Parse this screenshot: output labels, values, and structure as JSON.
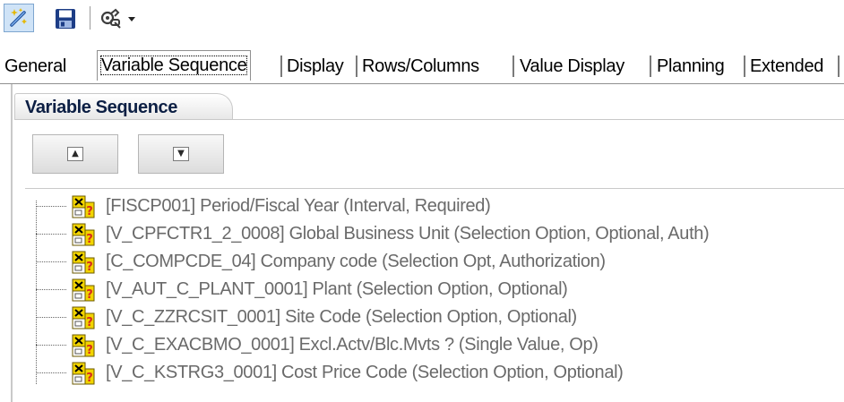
{
  "toolbar": {
    "buttons": [
      {
        "icon": "magic-wand-icon",
        "pressed": true
      },
      {
        "icon": "floppy-disk-icon"
      },
      {
        "icon": "tools-icon",
        "dropdown": true
      }
    ]
  },
  "tabs": [
    {
      "label": "General"
    },
    {
      "label": "Variable Sequence",
      "active": true
    },
    {
      "label": "Display"
    },
    {
      "label": "Rows/Columns"
    },
    {
      "label": "Value Display"
    },
    {
      "label": "Planning"
    },
    {
      "label": "Extended"
    }
  ],
  "group": {
    "title": "Variable Sequence",
    "move_up_icon": "triangle-up-icon",
    "move_down_icon": "triangle-down-icon"
  },
  "variables": [
    {
      "label": "[FISCP001] Period/Fiscal Year (Interval, Required)"
    },
    {
      "label": "[V_CPFCTR1_2_0008] Global Business Unit (Selection Option, Optional, Auth)"
    },
    {
      "label": "[C_COMPCDE_04] Company code (Selection Opt, Authorization)"
    },
    {
      "label": "[V_AUT_C_PLANT_0001] Plant (Selection Option, Optional)"
    },
    {
      "label": "[V_C_ZZRCSIT_0001] Site Code (Selection Option, Optional)"
    },
    {
      "label": "[V_C_EXACBMO_0001] Excl.Actv/Blc.Mvts ? (Single Value, Op)"
    },
    {
      "label": "[V_C_KSTRG3_0001] Cost Price Code (Selection Option, Optional)"
    }
  ],
  "colors": {
    "accent": "#cfe3f7",
    "item_text": "#6a6a6a",
    "group_title": "#0c1f44",
    "icon_yellow": "#f2d400",
    "icon_red": "#d62a1e"
  }
}
